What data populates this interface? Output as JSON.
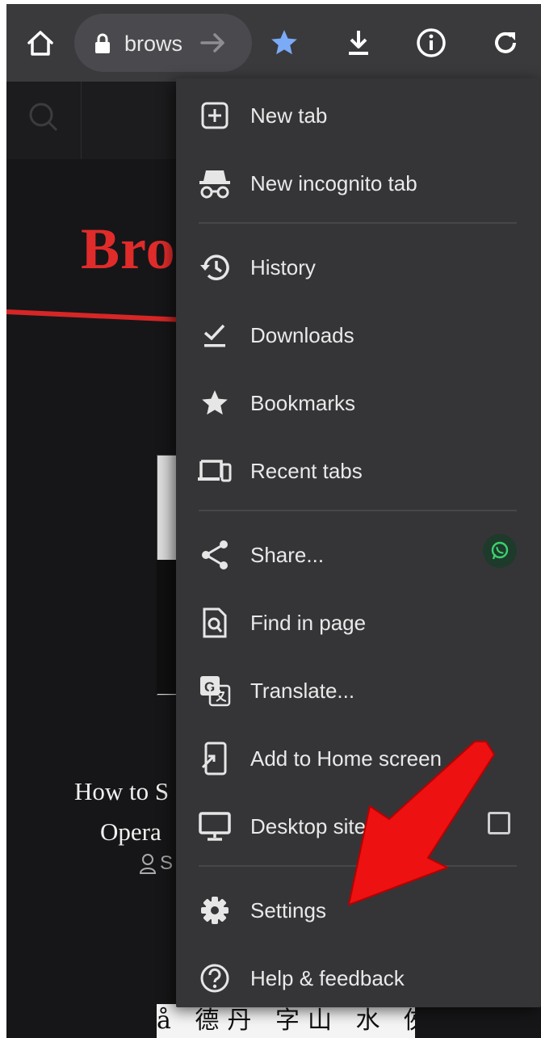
{
  "toolbar": {
    "url_text": "brows",
    "icons": [
      "home-icon",
      "lock-icon",
      "forward-arrow-icon",
      "bookmark-star-icon",
      "download-icon",
      "info-icon",
      "reload-icon"
    ],
    "accent": "#7baaf7"
  },
  "page": {
    "brand_text": "Bro",
    "article_title_line1": "How to S",
    "article_title_line2": "Opera",
    "author_text": "S",
    "bottom_text": "å 德丹 字山 水 俠"
  },
  "menu": {
    "items": [
      {
        "label": "New tab",
        "icon": "new-tab-icon"
      },
      {
        "label": "New incognito tab",
        "icon": "incognito-icon"
      },
      {
        "label": "History",
        "icon": "history-icon"
      },
      {
        "label": "Downloads",
        "icon": "downloads-check-icon"
      },
      {
        "label": "Bookmarks",
        "icon": "star-icon"
      },
      {
        "label": "Recent tabs",
        "icon": "devices-icon"
      },
      {
        "label": "Share...",
        "icon": "share-icon"
      },
      {
        "label": "Find in page",
        "icon": "find-in-page-icon"
      },
      {
        "label": "Translate...",
        "icon": "translate-icon"
      },
      {
        "label": "Add to Home screen",
        "icon": "add-to-home-icon"
      },
      {
        "label": "Desktop site",
        "icon": "desktop-icon"
      },
      {
        "label": "Settings",
        "icon": "gear-icon"
      },
      {
        "label": "Help & feedback",
        "icon": "help-icon"
      }
    ],
    "desktop_site_checked": false,
    "share_app": "whatsapp-icon"
  },
  "colors": {
    "toolbar_bg": "#3a3a3d",
    "menu_bg": "#353538",
    "brand_red": "#e02b2b",
    "arrow_red": "#ee1111"
  }
}
